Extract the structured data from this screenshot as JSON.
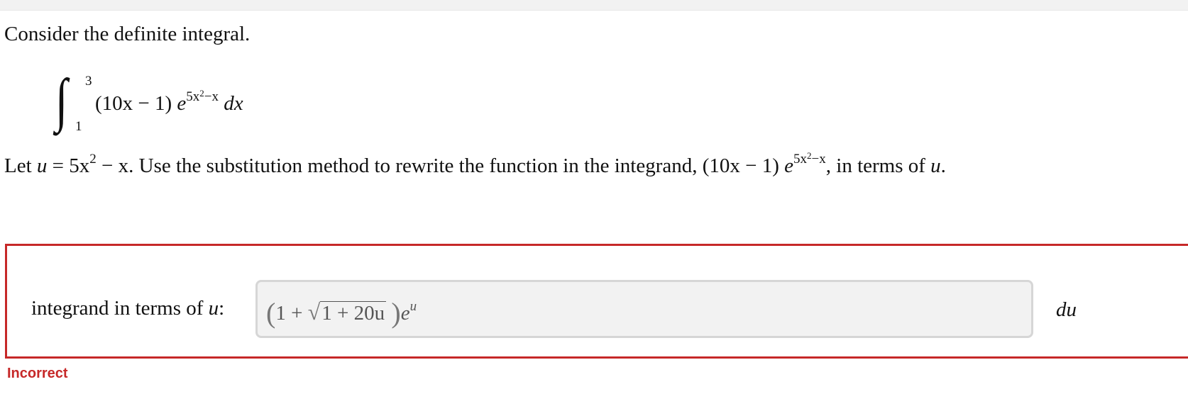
{
  "question": {
    "intro": "Consider the definite integral.",
    "integral": {
      "upper_limit": "3",
      "lower_limit": "1",
      "factor": "(10x − 1)",
      "base": "e",
      "exponent": "5x",
      "exponent_power": "2",
      "exponent_tail": "−x",
      "differential": "dx"
    },
    "substitution_text": {
      "let": "Let",
      "u": "u",
      "equals": "=",
      "expr": "5x",
      "expr_power": "2",
      "expr_tail": "− x",
      "instruction": ". Use the substitution method to rewrite the function in the integrand,",
      "integrand_factor": "(10x − 1)",
      "integrand_base": "e",
      "integrand_exp": "5x",
      "integrand_exp_power": "2",
      "integrand_exp_tail": "−x",
      "ending": ", in terms of",
      "ending_var": "u",
      "period": "."
    }
  },
  "answer": {
    "label_text": "integrand in terms of",
    "label_var": "u",
    "label_colon": ":",
    "input_value": {
      "open_paren": "(",
      "one": "1 +",
      "sqrt_symbol": "√",
      "radicand": "1 + 20u",
      "close_paren": ")",
      "base": "e",
      "exponent": "u"
    },
    "differential": "du"
  },
  "status": {
    "text": "Incorrect",
    "color": "#c62828"
  }
}
